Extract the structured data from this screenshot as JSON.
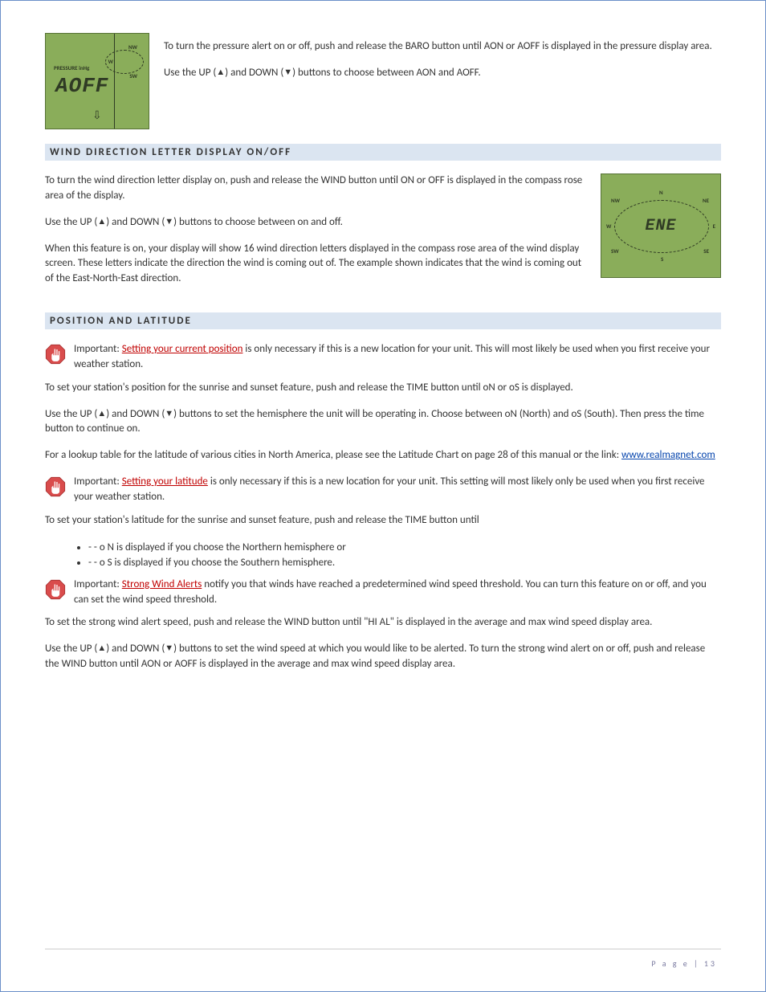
{
  "lcd1": {
    "label": "PRESSURE inHg",
    "value": "AOFF",
    "arrow": "⇩"
  },
  "lcd2": {
    "value": "ENE",
    "n": "N",
    "s": "S",
    "e": "E",
    "w": "W",
    "ne": "NE",
    "nw": "NW",
    "se": "SE",
    "sw": "SW"
  },
  "p_top_1": "To turn the pressure alert on or off, push and release the BARO button until AON or AOFF is displayed in the pressure display area.",
  "p_top_2_a": "Use the UP (",
  "p_top_2_b": ") and DOWN (",
  "p_top_2_c": ") buttons to choose between AON and AOFF.",
  "head_wind": "WIND DIRECTION LETTER DISPLAY ON/OFF",
  "p_w1": "To turn the wind direction letter display on, push and release the WIND button until ON or OFF is displayed in the compass rose area of the display.",
  "p_w2_a": "Use the UP (",
  "p_w2_b": ") and DOWN (",
  "p_w2_c": ") buttons to choose between on and off.",
  "p_w3": "When this feature is on, your display will show 16 wind direction letters displayed in the compass rose area of the wind display screen. These letters indicate the direction the wind is coming out of. The example shown indicates that the wind is coming out of the East-North-East direction.",
  "head_pos": "POSITION AND LATITUDE",
  "stop1_a": "Important: ",
  "stop1_b": "Setting your current position",
  "stop1_c": " is only necessary if this is a new location for your unit. This will most likely be used when you first receive your weather station.",
  "p_pos1": "To set your station's position for the sunrise and sunset feature, push and release the TIME button until oN or oS is displayed.",
  "p_pos2_a": "Use the UP (",
  "p_pos2_b": ") and DOWN (",
  "p_pos2_c": ") buttons to set the hemisphere the unit will be operating in. Choose between oN (North) and oS (South). Then press the time button to continue on.",
  "p_pos3_a": "For a lookup table for the latitude of various cities in North America, please see the Latitude Chart on page 28 of this manual or the link: ",
  "p_pos3_link": "www.realmagnet.com",
  "stop2_a": "Important: ",
  "stop2_b": "Setting your latitude",
  "stop2_c": " is only necessary if this is a new location for your unit. This setting will most likely only be used when you first receive your weather station.",
  "p_lat1": "To set your station's latitude for the sunrise and sunset feature, push and release the TIME button until",
  "bullet1": "- - o N is displayed if you choose the Northern hemisphere or",
  "bullet2": "- - o S is displayed if you choose the Southern hemisphere.",
  "stop3_a": "Important: ",
  "stop3_b": "Strong Wind Alerts",
  "stop3_c": " notify you that winds have reached a predetermined wind speed threshold. You can turn this feature on or off, and you can set the wind speed threshold.",
  "p_alert1": "To set the strong wind alert speed, push and release the WIND button until \"HI AL\" is displayed in the average and max wind speed display area.",
  "p_alert2_a": "Use the UP (",
  "p_alert2_b": ") and DOWN (",
  "p_alert2_c": ") buttons to set the wind speed at which you would like to be alerted. To turn the strong wind alert on or off, push and release the WIND button until AON or AOFF is displayed in the average and max wind speed display area.",
  "footer": "P a g e | 13"
}
